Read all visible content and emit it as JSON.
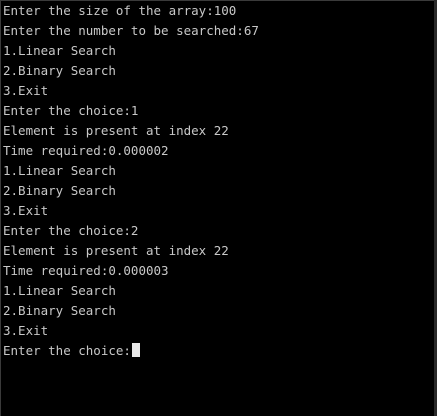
{
  "console": {
    "lines": [
      "Enter the size of the array:100",
      "Enter the number to be searched:67",
      "1.Linear Search",
      "2.Binary Search",
      "3.Exit",
      "Enter the choice:1",
      "Element is present at index 22",
      "Time required:0.000002",
      "1.Linear Search",
      "2.Binary Search",
      "3.Exit",
      "Enter the choice:2",
      "Element is present at index 22",
      "Time required:0.000003",
      "1.Linear Search",
      "2.Binary Search",
      "3.Exit",
      "Enter the choice:"
    ],
    "text_color": "#c8c8c8",
    "background": "#000000"
  }
}
